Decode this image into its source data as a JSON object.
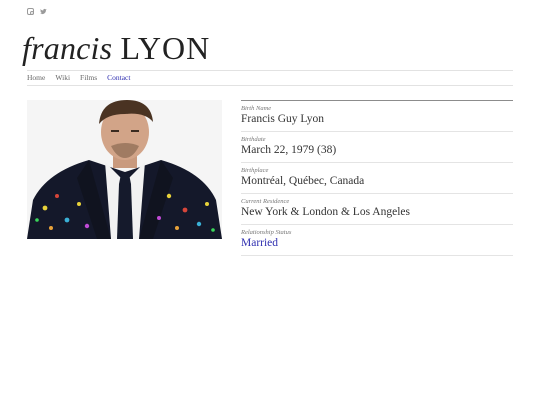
{
  "social": {
    "instagram_icon": "instagram-icon",
    "twitter_icon": "twitter-icon"
  },
  "header": {
    "first_name": "francis",
    "last_name": "LYON"
  },
  "nav": {
    "items": [
      "Home",
      "Wiki",
      "Films",
      "Contact"
    ],
    "active": "Contact"
  },
  "facts": [
    {
      "label": "Birth Name",
      "value": "Francis Guy Lyon"
    },
    {
      "label": "Birthdate",
      "value": "March 22, 1979 (38)"
    },
    {
      "label": "Birthplace",
      "value": "Montréal, Québec, Canada"
    },
    {
      "label": "Current Residence",
      "value": "New York & London & Los Angeles"
    },
    {
      "label": "Relationship Status",
      "value": "Married"
    }
  ],
  "colors": {
    "link": "#2f2fb0",
    "text": "#333333",
    "rule": "#e2e2e2"
  }
}
